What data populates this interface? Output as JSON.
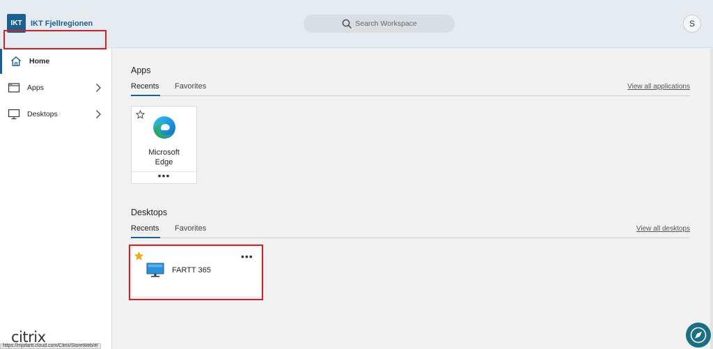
{
  "header": {
    "logo_text": "IKT",
    "brand_name": "IKT Fjellregionen",
    "search_placeholder": "Search Workspace",
    "user_initial": "S"
  },
  "sidebar": {
    "items": [
      {
        "label": "Home",
        "icon": "home-icon"
      },
      {
        "label": "Apps",
        "icon": "app-window-icon"
      },
      {
        "label": "Desktops",
        "icon": "monitor-icon"
      }
    ],
    "footer_logo": "citrix",
    "status_url": "https://mjofartt.cloud.com/Citrix/StoreWeb/#/"
  },
  "apps_section": {
    "title": "Apps",
    "tabs": [
      "Recents",
      "Favorites"
    ],
    "view_all": "View all applications",
    "cards": [
      {
        "name_line1": "Microsoft",
        "name_line2": "Edge",
        "favorite": false,
        "more": "•••"
      }
    ]
  },
  "desktops_section": {
    "title": "Desktops",
    "tabs": [
      "Recents",
      "Favorites"
    ],
    "view_all": "View all desktops",
    "cards": [
      {
        "name": "FARTT 365",
        "favorite": true,
        "more": "•••"
      }
    ]
  },
  "colors": {
    "accent": "#1b5f91",
    "highlight_outline": "#d0202a",
    "favorite_star": "#f2b400",
    "fab": "#1a6f86"
  }
}
